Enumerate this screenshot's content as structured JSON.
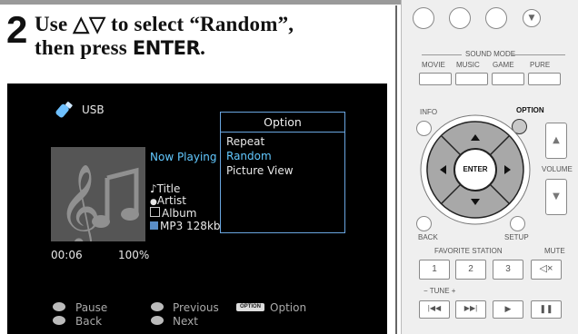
{
  "instruction": {
    "step_number": "2",
    "line1": "Use △▽ to select “Random”,",
    "line2_prefix": "then press ",
    "line2_key": "ENTER",
    "line2_suffix": "."
  },
  "screen": {
    "source": "USB",
    "now_playing": "Now Playing",
    "title": "Title",
    "artist": "Artist",
    "album": "Album",
    "format": "MP3 128kbps",
    "elapsed": "00:06",
    "progress": "100%",
    "progress_fraction": 1.0,
    "option_menu": {
      "header": "Option",
      "items": [
        "Repeat",
        "Random",
        "Picture View"
      ],
      "selected": "Random"
    },
    "hints": {
      "pause": "Pause",
      "back": "Back",
      "previous": "Previous",
      "next": "Next",
      "option_key": "OPTION",
      "option": "Option"
    }
  },
  "remote": {
    "sound_mode": "SOUND MODE",
    "movie": "MOVIE",
    "music": "MUSIC",
    "game": "GAME",
    "pure": "PURE",
    "info": "INFO",
    "option": "OPTION",
    "enter": "ENTER",
    "volume": "VOLUME",
    "back": "BACK",
    "setup": "SETUP",
    "favorite_station": "FAVORITE STATION",
    "mute": "MUTE",
    "fav1": "1",
    "fav2": "2",
    "fav3": "3",
    "tune": "TUNE",
    "tune_minus": "−",
    "tune_plus": "+"
  },
  "colors": {
    "selected_text": "#62c8ff",
    "menu_border": "#6aa6e0",
    "screen_bg": "#000000",
    "dpad": "#a8a8a8"
  }
}
